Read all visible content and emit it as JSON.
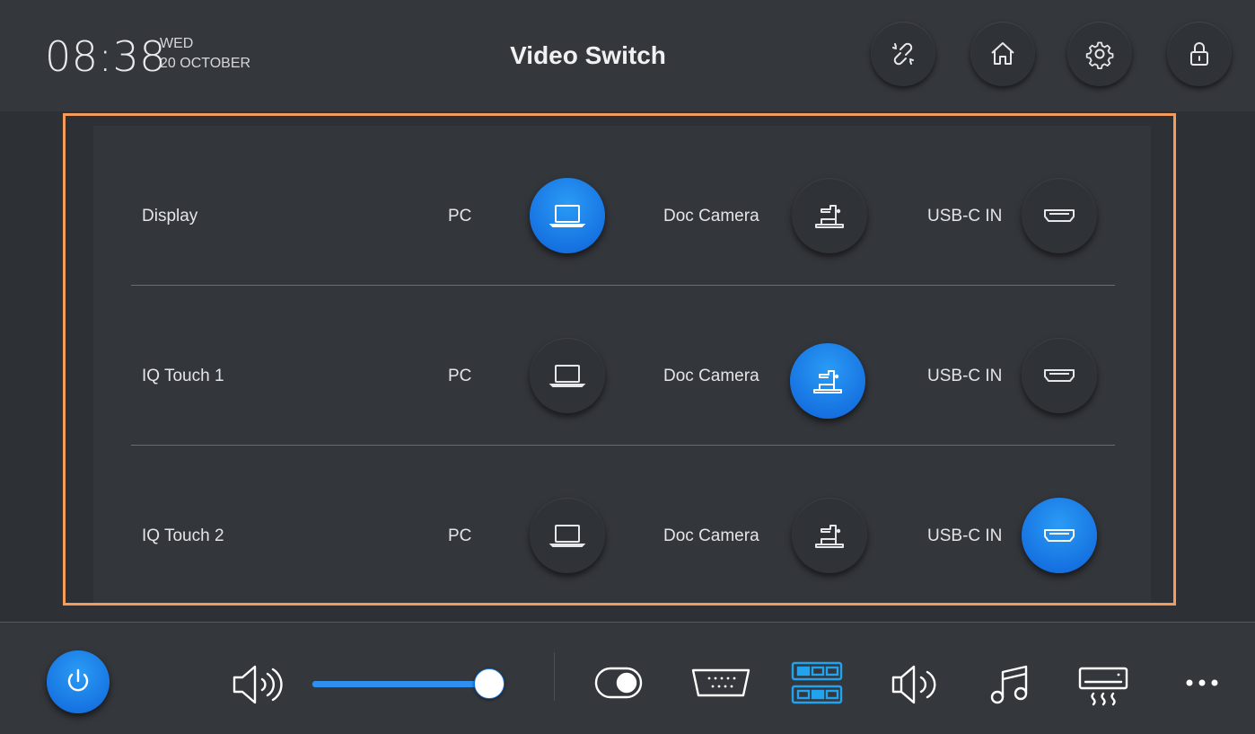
{
  "header": {
    "time": "08:38",
    "day": "WED",
    "date": "20 OCTOBER",
    "title": "Video Switch",
    "buttons": [
      {
        "icon": "unlink-icon"
      },
      {
        "icon": "home-icon"
      },
      {
        "icon": "gear-icon"
      },
      {
        "icon": "lock-icon"
      }
    ]
  },
  "rows": [
    {
      "label": "Display",
      "sources": [
        "PC",
        "Doc Camera",
        "USB-C IN"
      ],
      "active": "PC"
    },
    {
      "label": "IQ Touch 1",
      "sources": [
        "PC",
        "Doc Camera",
        "USB-C IN"
      ],
      "active": "Doc Camera"
    },
    {
      "label": "IQ Touch 2",
      "sources": [
        "PC",
        "Doc Camera",
        "USB-C IN"
      ],
      "active": "USB-C IN"
    }
  ],
  "bottom": {
    "volume_level": 0.92,
    "icons": [
      "power-icon",
      "speaker-icon",
      "toggle-icon",
      "vga-port-icon",
      "video-matrix-icon",
      "speaker-outline-icon",
      "music-note-icon",
      "air-conditioner-icon",
      "more-icon"
    ],
    "accent": "#1f86ee",
    "highlight_outline": "#f49c5b"
  }
}
